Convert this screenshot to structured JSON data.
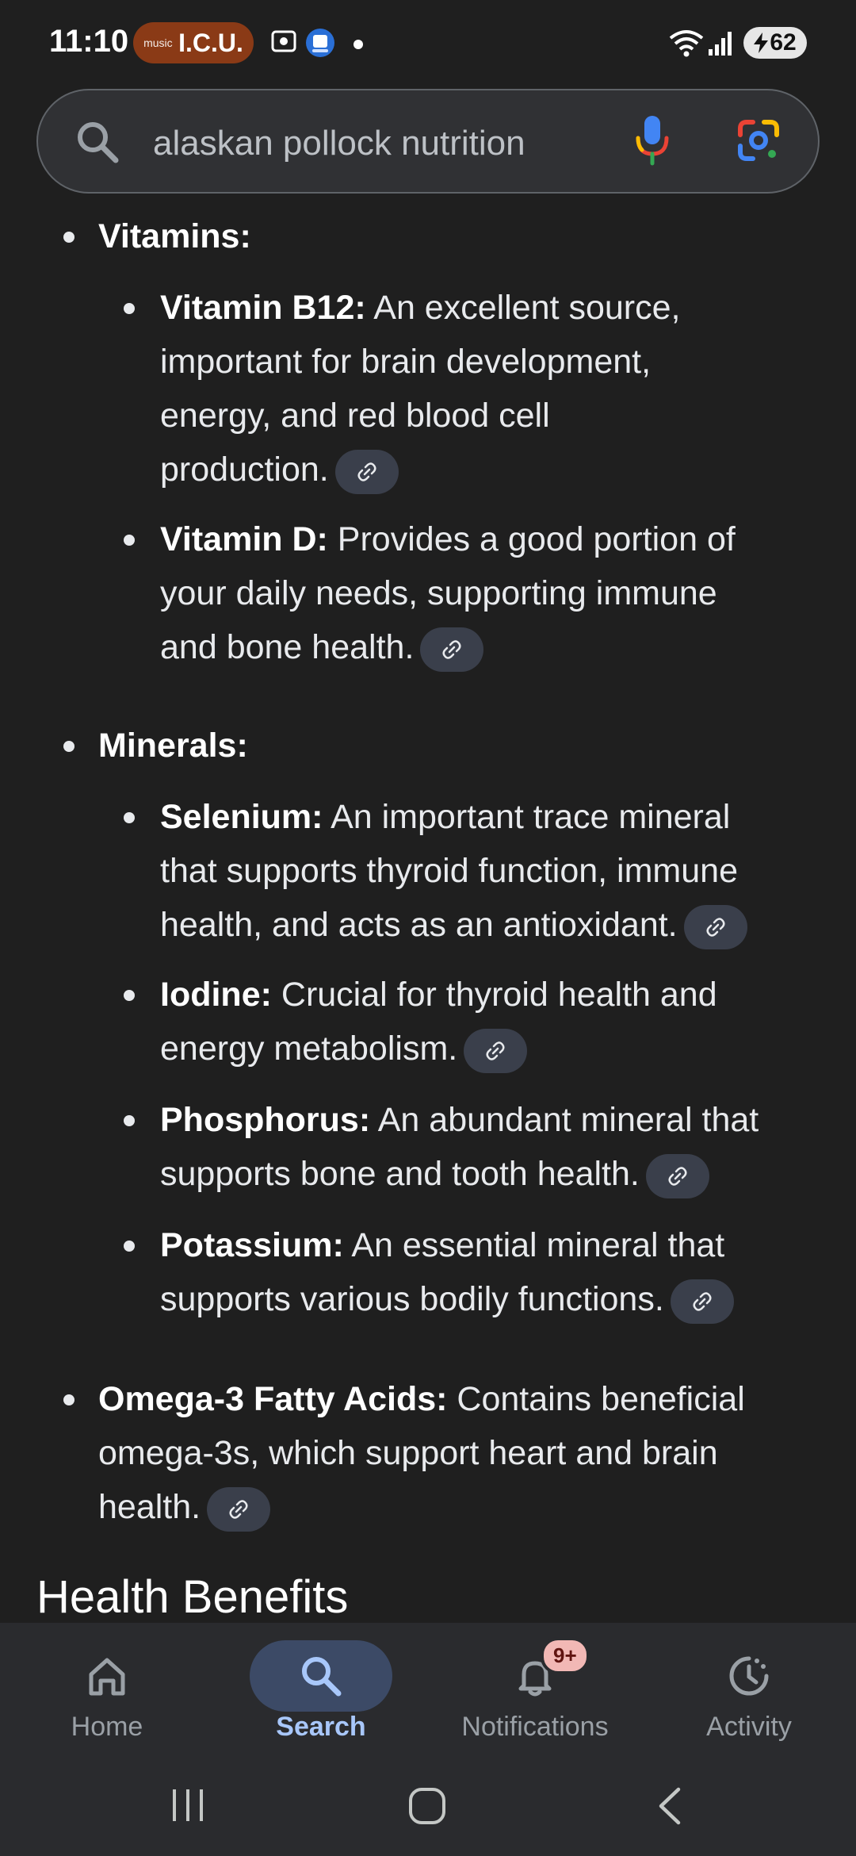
{
  "status_bar": {
    "time": "11:10",
    "music_title": "I.C.U.",
    "music_logo": "music",
    "battery": "62"
  },
  "search": {
    "query": "alaskan pollock nutrition"
  },
  "content": {
    "sections": [
      {
        "label": "Vitamins:",
        "items": [
          {
            "term": "Vitamin B12:",
            "line1": " An excellent source,",
            "line2": "important for brain development,",
            "line3": "energy, and red blood cell",
            "line4": "production."
          },
          {
            "term": "Vitamin D:",
            "line1": " Provides a good portion of",
            "line2": "your daily needs, supporting immune",
            "line3": "and bone health."
          }
        ]
      },
      {
        "label": "Minerals:",
        "items": [
          {
            "term": "Selenium:",
            "line1": " An important trace mineral",
            "line2": "that supports thyroid function, immune",
            "line3": "health, and acts as an antioxidant."
          },
          {
            "term": "Iodine:",
            "line1": " Crucial for thyroid health and",
            "line2": "energy metabolism."
          },
          {
            "term": "Phosphorus:",
            "line1": " An abundant mineral that",
            "line2": "supports bone and tooth health."
          },
          {
            "term": "Potassium:",
            "line1": " An essential mineral that",
            "line2": "supports various bodily functions."
          }
        ]
      },
      {
        "term": "Omega-3 Fatty Acids:",
        "line1": " Contains beneficial",
        "line2": "omega-3s, which support heart and brain",
        "line3": "health."
      }
    ],
    "next_heading": "Health Benefits"
  },
  "bottom_nav": {
    "items": [
      {
        "label": "Home",
        "icon": "home-icon"
      },
      {
        "label": "Search",
        "icon": "search-icon"
      },
      {
        "label": "Notifications",
        "icon": "bell-icon",
        "badge": "9+"
      },
      {
        "label": "Activity",
        "icon": "activity-icon"
      }
    ]
  },
  "colors": {
    "background": "#1f1f1f",
    "active_nav": "#a8c7fa",
    "music_pill": "#8a3a16"
  }
}
